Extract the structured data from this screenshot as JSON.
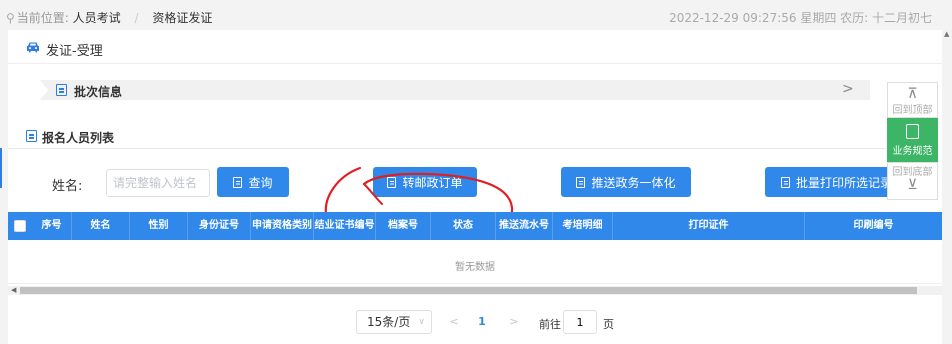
{
  "breadcrumb": {
    "prefix": "当前位置:",
    "item1": "人员考试",
    "separator": "/",
    "item2": "资格证发证"
  },
  "datetime": "2022-12-29 09:27:56 星期四 农历: 十二月初七",
  "page": {
    "title": "发证-受理"
  },
  "batch": {
    "title": "批次信息",
    "chevron": ">"
  },
  "list": {
    "title": "报名人员列表"
  },
  "search": {
    "label": "姓名:",
    "placeholder": "请完整输入姓名",
    "value": ""
  },
  "buttons": {
    "query": "查询",
    "post_order": "转邮政订单",
    "push_gov": "推送政务一体化",
    "batch_print": "批量打印所选记录"
  },
  "table": {
    "columns": [
      "序号",
      "姓名",
      "性别",
      "身份证号",
      "申请资格类别",
      "结业证书编号",
      "档案号",
      "状态",
      "推送流水号",
      "考培明细",
      "打印证件",
      "印刷编号"
    ],
    "empty_text": "暂无数据"
  },
  "pagination": {
    "page_size": "15条/页",
    "prev": "<",
    "current_page": "1",
    "next": ">",
    "goto_label": "前往",
    "goto_value": "1",
    "goto_suffix": "页"
  },
  "float_panel": {
    "back_top": "回到顶部",
    "spec": "业务规范",
    "back_bottom": "回到底部"
  },
  "colors": {
    "primary": "#2f88ea",
    "spec_green": "#3db566",
    "annotation_red": "#e02020"
  }
}
